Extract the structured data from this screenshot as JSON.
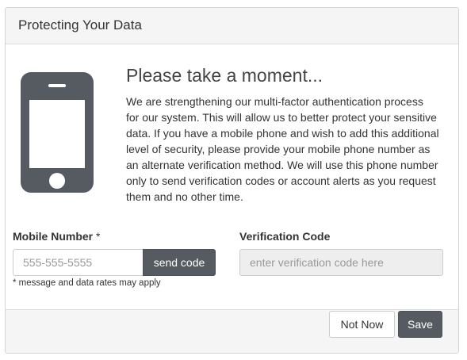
{
  "panel": {
    "title": "Protecting Your Data"
  },
  "illustration": {
    "icon": "mobile-phone-icon",
    "color": "#555b61"
  },
  "content": {
    "heading": "Please take a moment...",
    "intro": "We are strengthening our multi-factor authentication process for our system. This will allow us to better protect your sensitive data. If you have a mobile phone and wish to add this additional level of security, please provide your mobile phone number as an alternate verification method. We will use this phone number only to send verification codes or account alerts as you request them and no other time."
  },
  "form": {
    "mobile": {
      "label": "Mobile Number",
      "required_marker": "*",
      "placeholder": "555-555-5555",
      "value": "",
      "send_label": "send code",
      "note": "* message and data rates may apply"
    },
    "verification": {
      "label": "Verification Code",
      "placeholder": "enter verification code here",
      "value": "",
      "disabled": true
    }
  },
  "footer": {
    "not_now_label": "Not Now",
    "save_label": "Save"
  },
  "colors": {
    "accent_dark": "#555b61",
    "header_bg": "#f5f5f5",
    "border": "#dddddd"
  }
}
